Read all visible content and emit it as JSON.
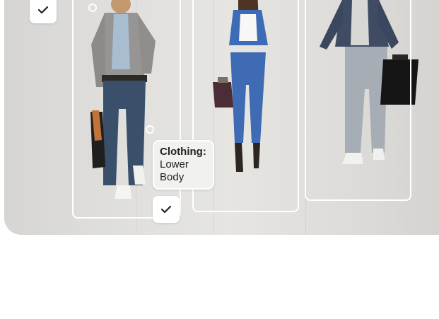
{
  "annotations": {
    "label_title": "Clothing:",
    "label_value": "Lower Body"
  },
  "icons": {
    "check": "checkmark-icon",
    "handle": "resize-handle-icon"
  },
  "colors": {
    "tag_background": "#f1f1ef",
    "box_outline": "#ffffff",
    "text": "#222222"
  }
}
